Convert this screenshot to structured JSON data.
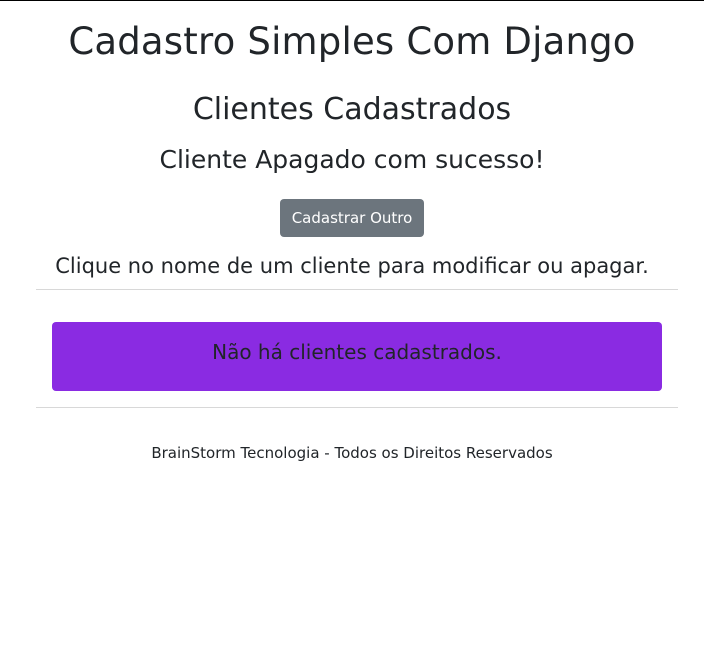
{
  "header": {
    "title": "Cadastro Simples Com Django"
  },
  "main": {
    "section_title": "Clientes Cadastrados",
    "success_message": "Cliente Apagado com sucesso!",
    "register_button_label": "Cadastrar Outro",
    "instruction": "Clique no nome de um cliente para modificar ou apagar.",
    "empty_message": "Não há clientes cadastrados."
  },
  "footer": {
    "text": "BrainStorm Tecnologia - Todos os Direitos Reservados"
  },
  "colors": {
    "empty_alert_background": "#8a2be2",
    "button_background": "#6c757d"
  }
}
